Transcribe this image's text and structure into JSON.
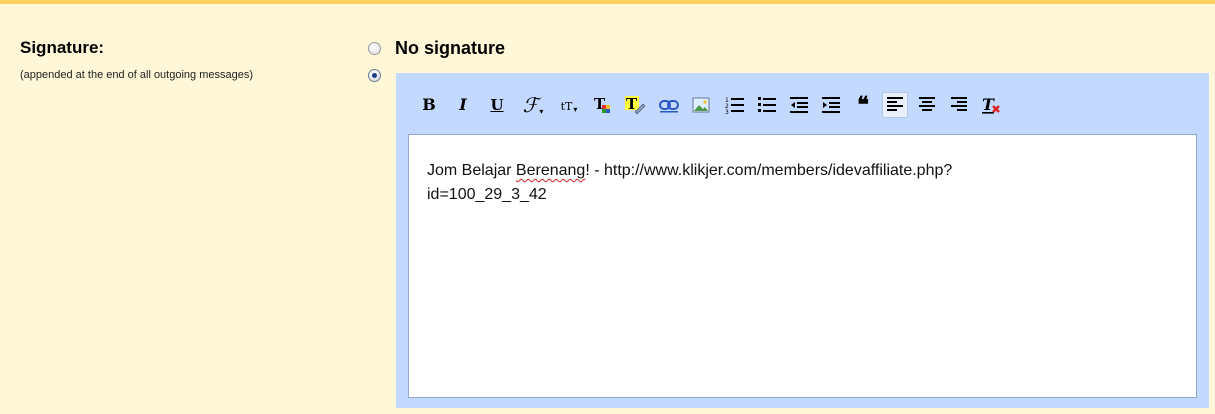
{
  "signature_section": {
    "label": "Signature:",
    "hint": "(appended at the end of all outgoing messages)",
    "option_none_label": "No signature",
    "selected": "custom"
  },
  "toolbar": {
    "bold": "B",
    "italic": "I",
    "underline": "U",
    "font": "ℱ",
    "size": "tT",
    "quote": "❝",
    "remove_format": "T"
  },
  "editor": {
    "text_before": "Jom Belajar ",
    "misspelled": "Berenang",
    "text_after": "! - http://www.klikjer.com/members/idevaffiliate.php?",
    "line2": "id=100_29_3_42"
  },
  "colors": {
    "panel_bg": "#fff7d7",
    "panel_border": "#fad163",
    "editor_frame": "#c3d9ff",
    "link_blue": "#2a58c4"
  },
  "icons": [
    "bold-icon",
    "italic-icon",
    "underline-icon",
    "font-icon",
    "font-size-icon",
    "text-color-icon",
    "highlight-icon",
    "link-icon",
    "image-icon",
    "numbered-list-icon",
    "bulleted-list-icon",
    "outdent-icon",
    "indent-icon",
    "quote-icon",
    "align-left-icon",
    "align-center-icon",
    "align-right-icon",
    "remove-formatting-icon"
  ]
}
